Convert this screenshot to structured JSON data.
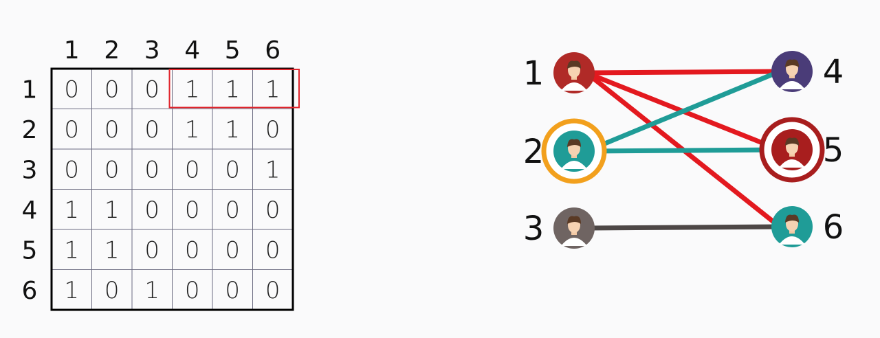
{
  "matrix": {
    "column_labels": [
      "1",
      "2",
      "3",
      "4",
      "5",
      "6"
    ],
    "row_labels": [
      "1",
      "2",
      "3",
      "4",
      "5",
      "6"
    ],
    "cells": [
      [
        "0",
        "0",
        "0",
        "1",
        "1",
        "1"
      ],
      [
        "0",
        "0",
        "0",
        "1",
        "1",
        "0"
      ],
      [
        "0",
        "0",
        "0",
        "0",
        "0",
        "1"
      ],
      [
        "1",
        "1",
        "0",
        "0",
        "0",
        "0"
      ],
      [
        "1",
        "1",
        "0",
        "0",
        "0",
        "0"
      ],
      [
        "1",
        "0",
        "1",
        "0",
        "0",
        "0"
      ]
    ],
    "highlight": {
      "row": 0,
      "cols": [
        3,
        5
      ],
      "color": "#e0242b"
    }
  },
  "graph": {
    "nodes": [
      {
        "id": "1",
        "label": "1",
        "color": "#b02a27",
        "ring": ""
      },
      {
        "id": "2",
        "label": "2",
        "color": "#1f9c97",
        "ring": "#f2a01d"
      },
      {
        "id": "3",
        "label": "3",
        "color": "#6f6462",
        "ring": ""
      },
      {
        "id": "4",
        "label": "4",
        "color": "#4a3c78",
        "ring": ""
      },
      {
        "id": "5",
        "label": "5",
        "color": "#a81e1e",
        "ring": "#a81e1e"
      },
      {
        "id": "6",
        "label": "6",
        "color": "#1f9c97",
        "ring": ""
      }
    ],
    "edges": [
      {
        "from": "1",
        "to": "4",
        "color": "#e3191f"
      },
      {
        "from": "1",
        "to": "5",
        "color": "#e3191f"
      },
      {
        "from": "1",
        "to": "6",
        "color": "#e3191f"
      },
      {
        "from": "2",
        "to": "4",
        "color": "#1f9c97"
      },
      {
        "from": "2",
        "to": "5",
        "color": "#1f9c97"
      },
      {
        "from": "3",
        "to": "6",
        "color": "#4d4746"
      }
    ]
  }
}
